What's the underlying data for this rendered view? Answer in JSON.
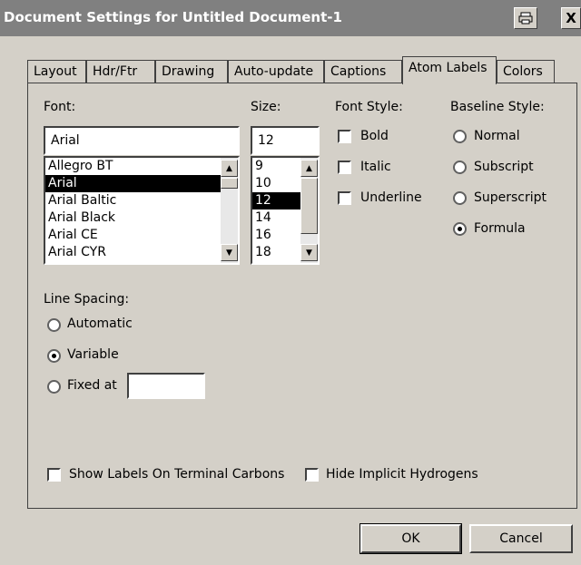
{
  "window": {
    "title": "Document Settings for Untitled Document-1",
    "print_icon": "printer-icon",
    "close_label": "X"
  },
  "tabs": [
    {
      "label": "Layout"
    },
    {
      "label": "Hdr/Ftr"
    },
    {
      "label": "Drawing"
    },
    {
      "label": "Auto-update"
    },
    {
      "label": "Captions"
    },
    {
      "label": "Atom Labels",
      "active": true
    },
    {
      "label": "Colors"
    }
  ],
  "font": {
    "label": "Font:",
    "value": "Arial",
    "options": [
      "Allegro BT",
      "Arial",
      "Arial Baltic",
      "Arial Black",
      "Arial CE",
      "Arial CYR"
    ],
    "selected": "Arial"
  },
  "size": {
    "label": "Size:",
    "value": "12",
    "options": [
      "9",
      "10",
      "12",
      "14",
      "16",
      "18"
    ],
    "selected": "12"
  },
  "font_style": {
    "label": "Font Style:",
    "options": [
      {
        "label": "Bold",
        "checked": false
      },
      {
        "label": "Italic",
        "checked": false
      },
      {
        "label": "Underline",
        "checked": false
      }
    ]
  },
  "baseline_style": {
    "label": "Baseline Style:",
    "options": [
      {
        "label": "Normal",
        "selected": false
      },
      {
        "label": "Subscript",
        "selected": false
      },
      {
        "label": "Superscript",
        "selected": false
      },
      {
        "label": "Formula",
        "selected": true
      }
    ]
  },
  "line_spacing": {
    "label": "Line Spacing:",
    "options": [
      {
        "label": "Automatic",
        "selected": false
      },
      {
        "label": "Variable",
        "selected": true
      },
      {
        "label": "Fixed at",
        "selected": false
      }
    ],
    "fixed_value": ""
  },
  "options": {
    "show_labels": {
      "label": "Show Labels On Terminal Carbons",
      "checked": false
    },
    "hide_hydrogens": {
      "label": "Hide Implicit Hydrogens",
      "checked": false
    }
  },
  "buttons": {
    "ok": "OK",
    "cancel": "Cancel"
  }
}
